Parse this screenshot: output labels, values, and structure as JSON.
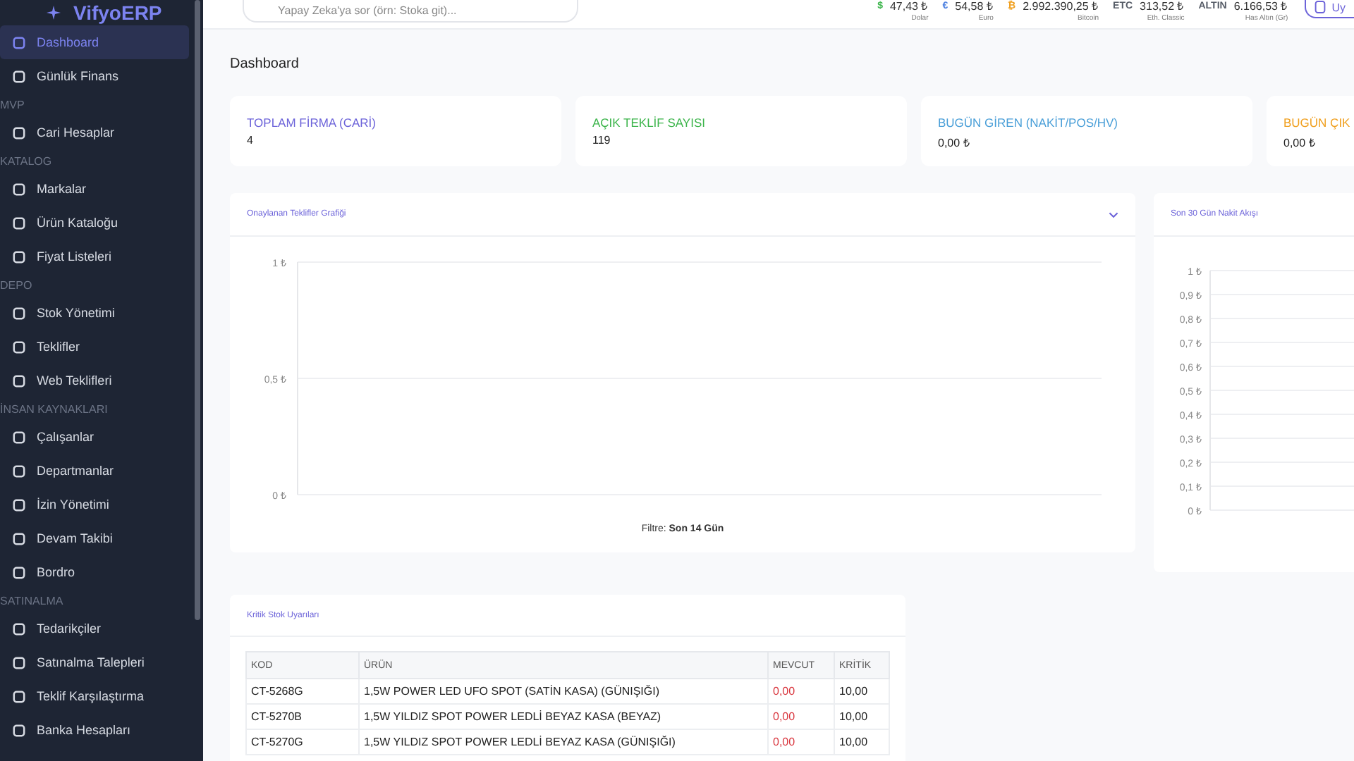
{
  "sidebar": {
    "logo": "VifyoERP",
    "groups": [
      {
        "items": [
          {
            "label": "Dashboard",
            "selected": true
          },
          {
            "label": "Günlük Finans",
            "selected": false
          }
        ]
      },
      {
        "title": "MVP",
        "items": [
          {
            "label": "Cari Hesaplar",
            "selected": false
          }
        ]
      },
      {
        "title": "KATALOG",
        "items": [
          {
            "label": "Markalar",
            "selected": false
          },
          {
            "label": "Ürün Kataloğu",
            "selected": false
          },
          {
            "label": "Fiyat Listeleri",
            "selected": false
          }
        ]
      },
      {
        "title": "DEPO",
        "items": [
          {
            "label": "Stok Yönetimi",
            "selected": false
          },
          {
            "label": "Teklifler",
            "selected": false
          },
          {
            "label": "Web Teklifleri",
            "selected": false
          }
        ]
      },
      {
        "title": "İNSAN KAYNAKLARI",
        "items": [
          {
            "label": "Çalışanlar",
            "selected": false
          },
          {
            "label": "Departmanlar",
            "selected": false
          },
          {
            "label": "İzin Yönetimi",
            "selected": false
          },
          {
            "label": "Devam Takibi",
            "selected": false
          },
          {
            "label": "Bordro",
            "selected": false
          }
        ]
      },
      {
        "title": "SATINALMA",
        "items": [
          {
            "label": "Tedarikçiler",
            "selected": false
          },
          {
            "label": "Satınalma Talepleri",
            "selected": false
          },
          {
            "label": "Teklif Karşılaştırma",
            "selected": false
          },
          {
            "label": "Banka Hesapları",
            "selected": false
          }
        ]
      }
    ]
  },
  "top_bar": {
    "search": {
      "placeholder": "Yapay Zeka'ya sor (örn: Stoka git)..."
    },
    "tickers": [
      {
        "symbol": "$",
        "value": "47,43 ₺",
        "caption": "Dolar",
        "color": "#3bb44a"
      },
      {
        "symbol": "€",
        "value": "54,58 ₺",
        "caption": "Euro",
        "color": "#4a7fe0"
      },
      {
        "symbol": "₿",
        "value": "2.992.390,25 ₺",
        "caption": "Bitcoin",
        "color": "#f0a020"
      },
      {
        "symbol": "ETC",
        "value": "313,52 ₺",
        "caption": "Eth. Classic",
        "color": "#555b66"
      },
      {
        "symbol": "ALTIN",
        "value": "6.166,53 ₺",
        "caption": "Has Altın (Gr)",
        "color": "#555b66"
      }
    ],
    "button": "Uy"
  },
  "page_title": "Dashboard",
  "stats": [
    {
      "title": "TOPLAM FİRMA (CARİ)",
      "value": "4",
      "color": "#6c63d9"
    },
    {
      "title": "AÇIK TEKLİF SAYISI",
      "value": "119",
      "color": "#3bb44a"
    },
    {
      "title": "BUGÜN GİREN (NAKİT/POS/HV)",
      "value": "0,00 ₺",
      "color": "#4a9fd8"
    },
    {
      "title": "BUGÜN ÇIK",
      "value": "0,00 ₺",
      "color": "#f0a020"
    }
  ],
  "approved_chart": {
    "title": "Onaylanan Teklifler Grafiği",
    "footer": "Filtre: **Son 14 Gün**",
    "axis_labels": [
      "1 ₺",
      "0,5 ₺",
      "0 ₺"
    ]
  },
  "cash_chart": {
    "title": "Son 30 Gün Nakit Akışı",
    "axis_labels": [
      "1 ₺",
      "0,9 ₺",
      "0,8 ₺",
      "0,7 ₺",
      "0,6 ₺",
      "0,5 ₺",
      "0,4 ₺",
      "0,3 ₺",
      "0,2 ₺",
      "0,1 ₺",
      "0 ₺"
    ]
  },
  "critical_stock": {
    "title": "Kritik Stok Uyarıları",
    "columns": [
      "KOD",
      "ÜRÜN",
      "MEVCUT",
      "KRİTİK"
    ],
    "rows": [
      [
        "CT-5268G",
        "1,5W POWER LED UFO SPOT (SATİN KASA) (GÜNIŞIĞI)",
        "0,00",
        "10,00"
      ],
      [
        "CT-5270B",
        "1,5W YILDIZ SPOT POWER LEDLİ BEYAZ KASA (BEYAZ)",
        "0,00",
        "10,00"
      ],
      [
        "CT-5270G",
        "1,5W YILDIZ SPOT POWER LEDLİ BEYAZ KASA (GÜNIŞIĞI)",
        "0,00",
        "10,00"
      ]
    ]
  }
}
